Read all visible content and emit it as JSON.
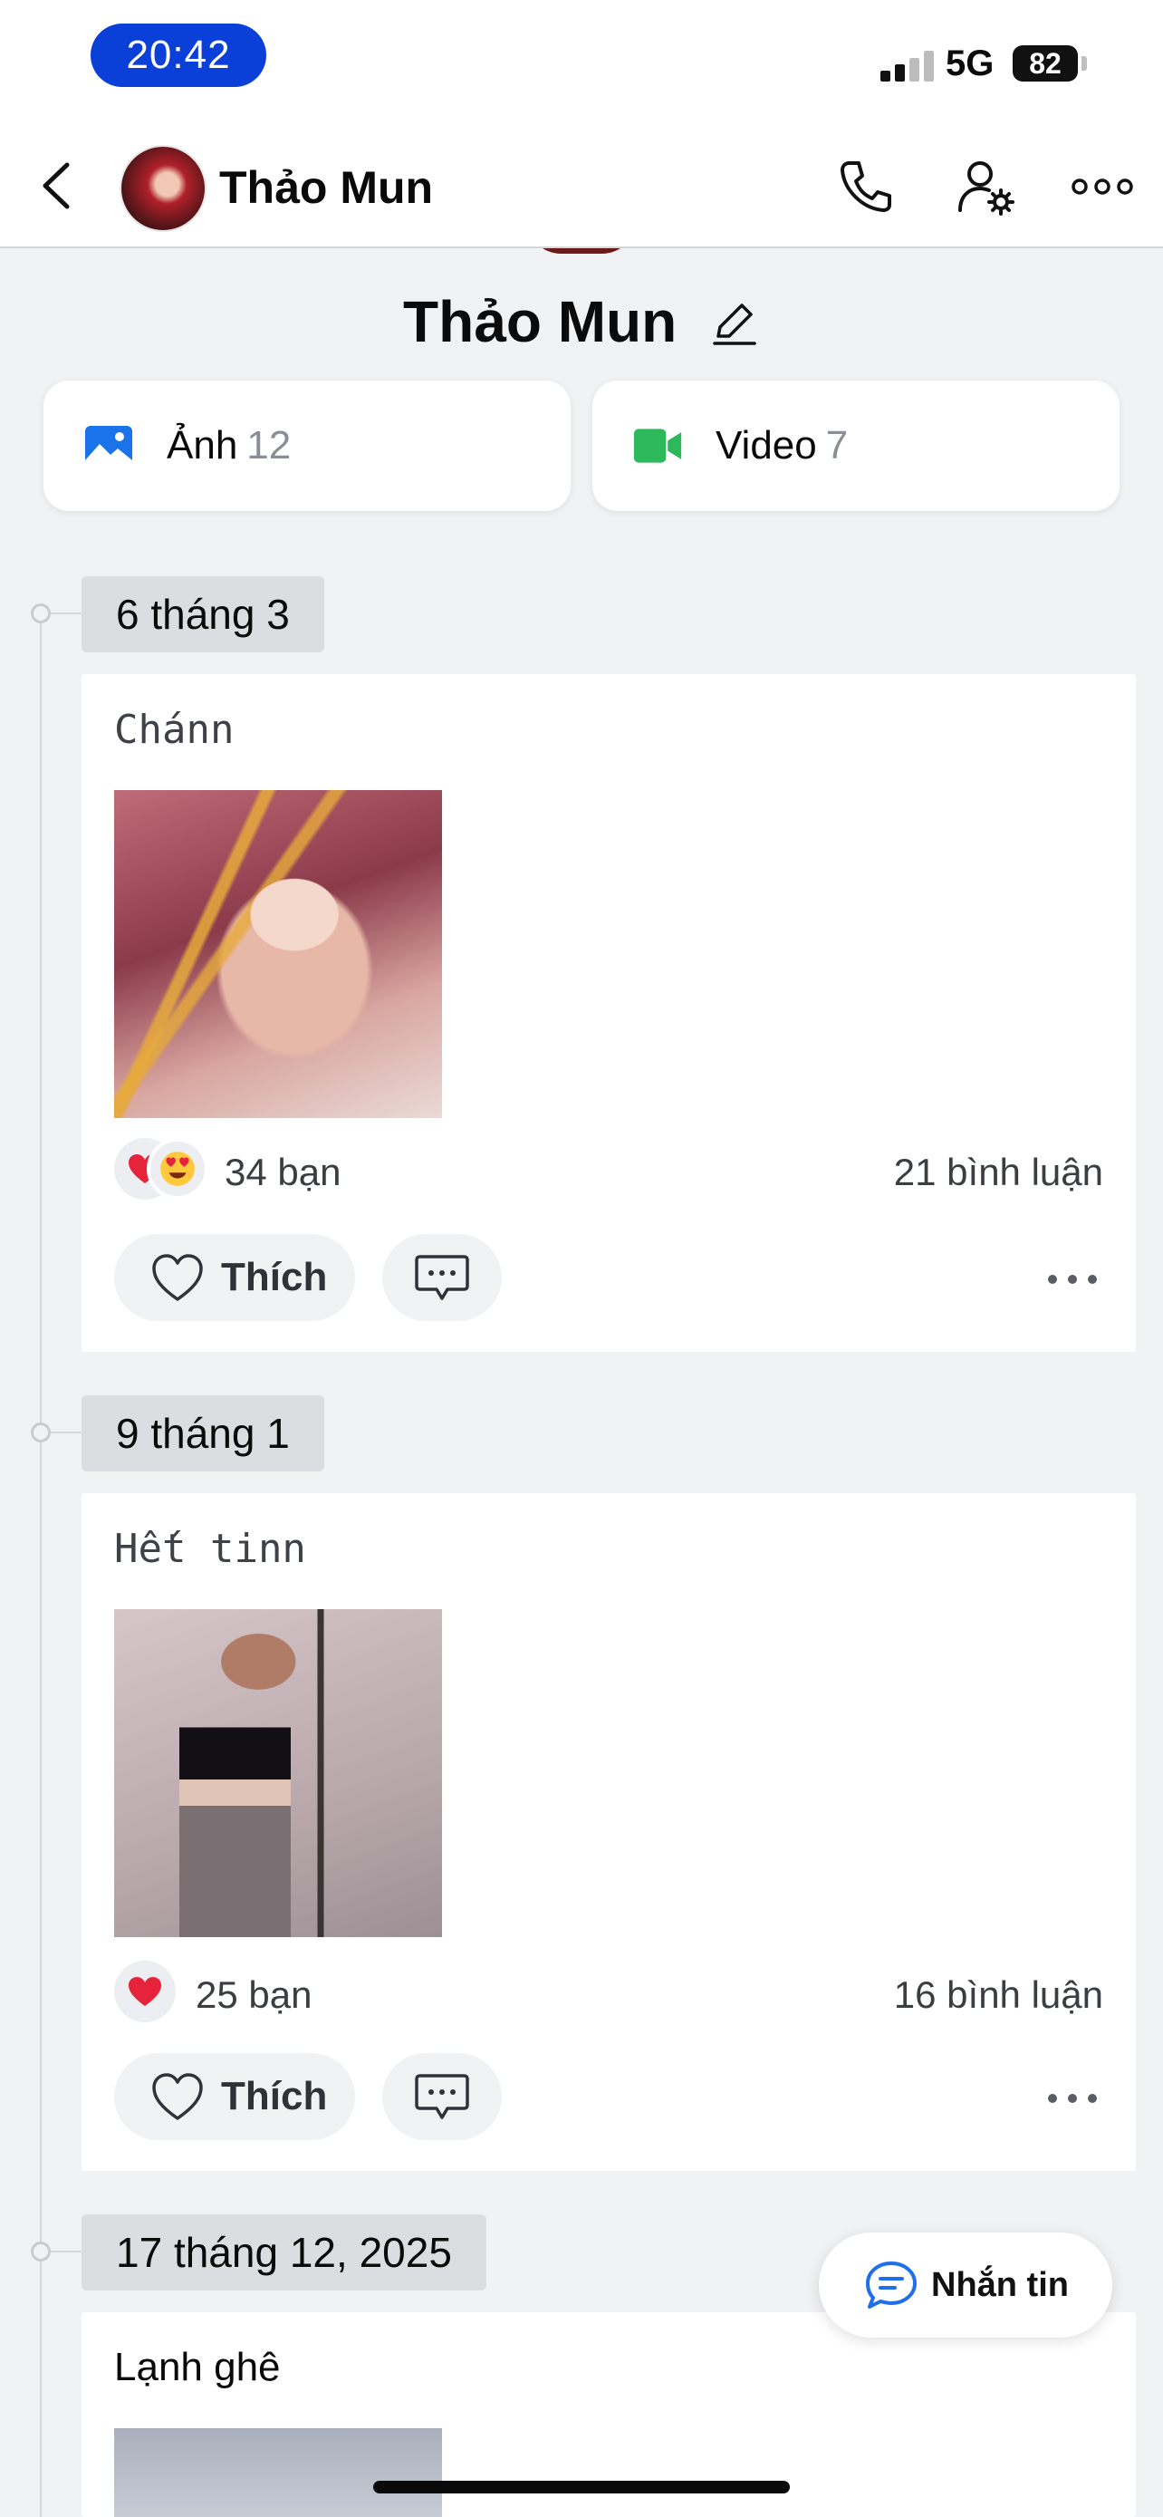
{
  "status_bar": {
    "time": "20:42",
    "network": "5G",
    "battery": "82"
  },
  "header": {
    "title": "Thảo Mun"
  },
  "profile": {
    "name": "Thảo Mun"
  },
  "media": [
    {
      "label": "Ảnh",
      "count": "12"
    },
    {
      "label": "Video",
      "count": "7"
    }
  ],
  "posts": [
    {
      "date": "6 tháng 3",
      "text": "Chánn",
      "reactions": "34 bạn",
      "comments": "21 bình luận",
      "like_label": "Thích"
    },
    {
      "date": "9 tháng 1",
      "text": "Hết tinn",
      "reactions": "25 bạn",
      "comments": "16 bình luận",
      "like_label": "Thích"
    },
    {
      "date": "17 tháng 12, 2025",
      "text": "Lạnh ghê"
    }
  ],
  "fab": {
    "label": "Nhắn tin"
  },
  "colors": {
    "time_pill": "#0a3fd8",
    "photo_icon": "#1a73e8",
    "video_icon": "#2eb85c",
    "heart": "#e5243b",
    "accent": "#1f6feb"
  }
}
